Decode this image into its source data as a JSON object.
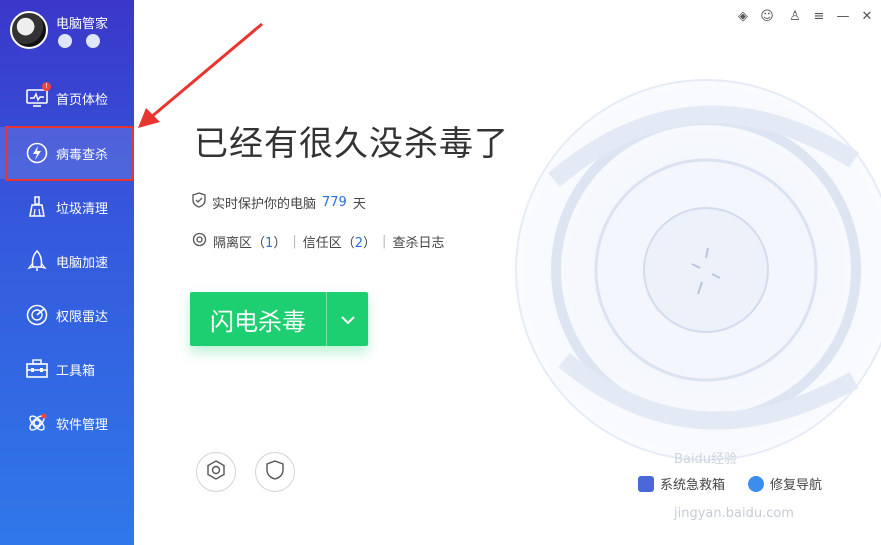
{
  "sidebar": {
    "app_name": "电脑管家",
    "items": [
      {
        "label": "首页体检",
        "icon": "monitor-icon"
      },
      {
        "label": "病毒查杀",
        "icon": "lightning-icon"
      },
      {
        "label": "垃圾清理",
        "icon": "broom-icon"
      },
      {
        "label": "电脑加速",
        "icon": "rocket-icon"
      },
      {
        "label": "权限雷达",
        "icon": "radar-icon"
      },
      {
        "label": "工具箱",
        "icon": "toolbox-icon"
      },
      {
        "label": "软件管理",
        "icon": "software-icon"
      }
    ],
    "badge": "!"
  },
  "main": {
    "headline": "已经有很久没杀毒了",
    "protect_text": "实时保护你的电脑",
    "protect_days": "779",
    "protect_unit": "天",
    "quarantine_label": "隔离区",
    "quarantine_count": "1",
    "trust_label": "信任区",
    "trust_count": "2",
    "log_label": "查杀日志",
    "scan_button": "闪电杀毒",
    "bottom_left": "系统急救箱",
    "bottom_right": "修复导航"
  },
  "watermark": {
    "text": "Baidu经验",
    "url": "jingyan.baidu.com"
  },
  "colors": {
    "accent_green": "#1ecf72",
    "sidebar_top": "#3a37c9",
    "sidebar_bottom": "#2f78ea",
    "highlight_red": "#e8352f"
  }
}
